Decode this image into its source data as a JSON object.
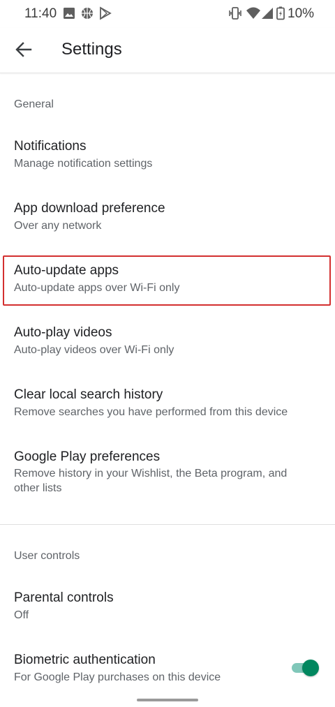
{
  "status_bar": {
    "time": "11:40",
    "battery": "10%",
    "left_icons": [
      "image-icon",
      "basketball-icon",
      "play-store-icon"
    ],
    "right_icons": [
      "vibrate-icon",
      "wifi-icon",
      "signal-icon",
      "battery-icon"
    ]
  },
  "app_bar": {
    "title": "Settings"
  },
  "sections": {
    "general": {
      "header": "General",
      "items": [
        {
          "title": "Notifications",
          "subtitle": "Manage notification settings"
        },
        {
          "title": "App download preference",
          "subtitle": "Over any network"
        },
        {
          "title": "Auto-update apps",
          "subtitle": "Auto-update apps over Wi-Fi only"
        },
        {
          "title": "Auto-play videos",
          "subtitle": "Auto-play videos over Wi-Fi only"
        },
        {
          "title": "Clear local search history",
          "subtitle": "Remove searches you have performed from this device"
        },
        {
          "title": "Google Play preferences",
          "subtitle": "Remove history in your Wishlist, the Beta program, and other lists"
        }
      ]
    },
    "user_controls": {
      "header": "User controls",
      "items": [
        {
          "title": "Parental controls",
          "subtitle": "Off"
        },
        {
          "title": "Biometric authentication",
          "subtitle": "For Google Play purchases on this device",
          "toggle_on": true
        }
      ]
    }
  },
  "colors": {
    "accent": "#01875f",
    "highlight": "#d32f2f"
  }
}
